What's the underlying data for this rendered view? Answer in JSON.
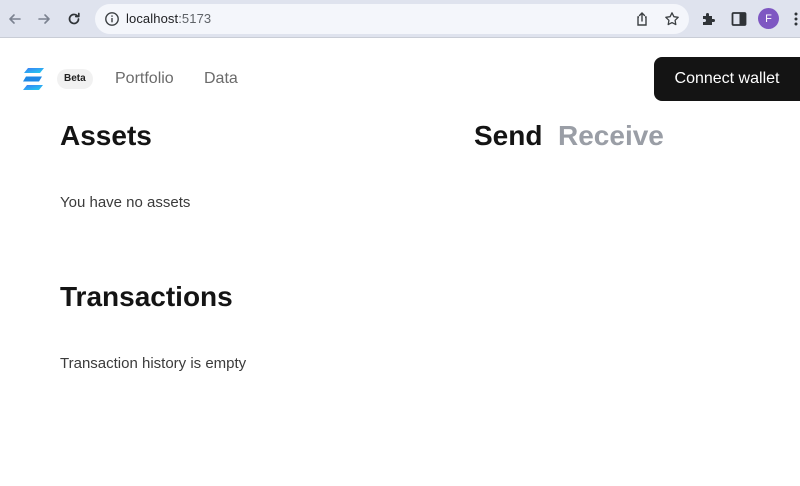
{
  "browser": {
    "url_host": "localhost",
    "url_port": ":5173",
    "profile_initial": "F"
  },
  "app": {
    "beta_badge": "Beta",
    "nav": [
      {
        "label": "Portfolio"
      },
      {
        "label": "Data"
      }
    ],
    "connect_wallet_label": "Connect wallet"
  },
  "assets": {
    "title": "Assets",
    "empty_text": "You have no assets"
  },
  "transactions": {
    "title": "Transactions",
    "empty_text": "Transaction history is empty"
  },
  "transfer_tabs": [
    {
      "label": "Send",
      "active": true
    },
    {
      "label": "Receive",
      "active": false
    }
  ],
  "colors": {
    "chrome_bg": "#dfe3ee",
    "button_bg": "#141414",
    "profile_bg": "#7e57c2",
    "inactive_tab": "#9a9ea6",
    "logo_gradient_start": "#3b7bf6",
    "logo_gradient_end": "#22d3ee"
  },
  "icons": [
    "back-arrow-icon",
    "forward-arrow-icon",
    "reload-icon",
    "site-info-icon",
    "share-icon",
    "bookmark-star-icon",
    "extensions-puzzle-icon",
    "side-panel-icon",
    "menu-kebab-icon",
    "app-logo-icon"
  ]
}
